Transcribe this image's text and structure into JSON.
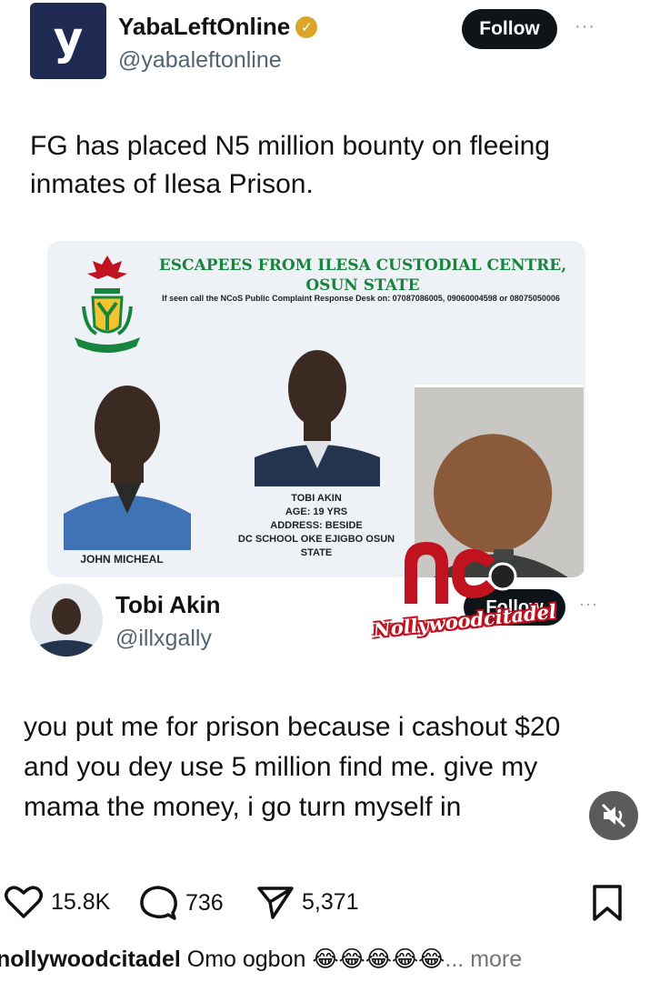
{
  "post": {
    "author_name": "YabaLeftOnline",
    "author_handle": "@yabaleftonline",
    "logo_letter": "y",
    "follow_label": "Follow",
    "more": "···",
    "text": "FG has placed N5 million bounty on fleeing inmates of Ilesa Prison."
  },
  "poster": {
    "title": "ESCAPEES FROM ILESA CUSTODIAL CENTRE, OSUN STATE",
    "desk_line": "If seen call the NCoS Public Complaint Response Desk on: 07087086005, 09060004598 or 08075050006",
    "person1_label": "JOHN MICHEAL",
    "person2_label_lines": [
      "TOBI AKIN",
      "AGE: 19 YRS",
      "ADDRESS: BESIDE",
      "DC SCHOOL OKE EJIGBO OSUN",
      "STATE"
    ]
  },
  "quoted": {
    "author_name": "Tobi Akin",
    "author_handle": "@illxgally",
    "follow_label": "Follow",
    "more": "···",
    "text": "you put me for prison because i cashout $20 and you dey use 5 million find me. give my mama the money, i go turn myself in"
  },
  "watermark": {
    "text": "Nollywoodcitadel"
  },
  "actions": {
    "likes": "15.8K",
    "comments": "736",
    "shares": "5,371"
  },
  "caption": {
    "username": "nollywoodcitadel",
    "text": "Omo ogbon 😂😂😂😂😂",
    "more_label": "... more"
  },
  "colors": {
    "brand_navy": "#1f2a52",
    "verified_gold": "#d9a62a",
    "poster_green": "#17853e",
    "watermark_red": "#c1121f"
  }
}
